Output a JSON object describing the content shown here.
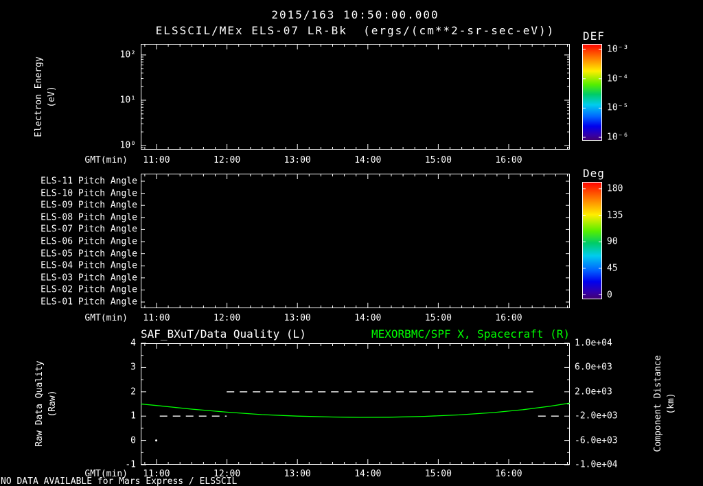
{
  "header": {
    "title": "2015/163 10:50:00.000",
    "subtitle": "ELSSCIL/MEx ELS-07 LR-Bk  (ergs/(cm**2-sr-sec-eV))"
  },
  "time_axis": {
    "label": "GMT(min)",
    "ticks": [
      "11:00",
      "12:00",
      "13:00",
      "14:00",
      "15:00",
      "16:00"
    ]
  },
  "energy_panel": {
    "ylabel": "Electron Energy\n(eV)",
    "yticks": [
      "10²",
      "10¹",
      "10⁰"
    ],
    "colorbar": {
      "title": "DEF",
      "ticks": [
        "10⁻³",
        "10⁻⁴",
        "10⁻⁵",
        "10⁻⁶"
      ]
    }
  },
  "pitch_panel": {
    "row_labels": [
      "ELS-11 Pitch Angle",
      "ELS-10 Pitch Angle",
      "ELS-09 Pitch Angle",
      "ELS-08 Pitch Angle",
      "ELS-07 Pitch Angle",
      "ELS-06 Pitch Angle",
      "ELS-05 Pitch Angle",
      "ELS-04 Pitch Angle",
      "ELS-03 Pitch Angle",
      "ELS-02 Pitch Angle",
      "ELS-01 Pitch Angle"
    ],
    "colorbar": {
      "title": "Deg",
      "ticks": [
        "180",
        "135",
        "90",
        "45",
        "0"
      ]
    }
  },
  "quality_panel": {
    "left_title": "SAF_BXuT/Data Quality (L)",
    "right_title": "MEXORBMC/SPF X, Spacecraft (R)",
    "left_ylabel": "Raw Data Quality\n(Raw)",
    "left_yticks": [
      "4",
      "3",
      "2",
      "1",
      "0",
      "-1"
    ],
    "right_ylabel": "Component Distance\n(km)",
    "right_yticks": [
      "1.0e+04",
      "6.0e+03",
      "2.0e+03",
      "-2.0e+03",
      "-6.0e+03",
      "-1.0e+04"
    ]
  },
  "status": "NO DATA AVAILABLE for Mars Express / ELSSCIL",
  "colors": {
    "foreground": "#ffffff",
    "background": "#000000",
    "series_green": "#00ff00"
  },
  "chart_data": [
    {
      "type": "heatmap",
      "panel": "electron-energy-spectrogram",
      "title": "ELSSCIL/MEx ELS-07 LR-Bk",
      "units": "ergs/(cm**2-sr-sec-eV)",
      "xlabel": "GMT(min)",
      "ylabel": "Electron Energy (eV)",
      "y_scale": "log",
      "y_tick_values": [
        100,
        10,
        1
      ],
      "x_ticks": [
        "11:00",
        "12:00",
        "13:00",
        "14:00",
        "15:00",
        "16:00"
      ],
      "colorbar": {
        "title": "DEF",
        "tick_values": [
          0.001,
          0.0001,
          1e-05,
          1e-06
        ]
      },
      "values": [],
      "note": "panel empty - no data available"
    },
    {
      "type": "heatmap",
      "panel": "pitch-angles",
      "rows": [
        "ELS-11",
        "ELS-10",
        "ELS-09",
        "ELS-08",
        "ELS-07",
        "ELS-06",
        "ELS-05",
        "ELS-04",
        "ELS-03",
        "ELS-02",
        "ELS-01"
      ],
      "x_ticks": [
        "11:00",
        "12:00",
        "13:00",
        "14:00",
        "15:00",
        "16:00"
      ],
      "colorbar": {
        "title": "Deg",
        "tick_values": [
          180,
          135,
          90,
          45,
          0
        ]
      },
      "values": [],
      "note": "panel empty - no data available"
    },
    {
      "type": "line",
      "panel": "quality-and-distance",
      "x_label": "GMT(min)",
      "x_ticks": [
        "11:00",
        "12:00",
        "13:00",
        "14:00",
        "15:00",
        "16:00"
      ],
      "x_range_hours": [
        10.78,
        16.87
      ],
      "left_axis": {
        "label": "Raw Data Quality (Raw)",
        "range": [
          -1,
          4
        ]
      },
      "right_axis": {
        "label": "Component Distance (km)",
        "range": [
          -10000,
          10000
        ]
      },
      "series": [
        {
          "name": "SAF_BXuT/Data Quality (L)",
          "axis": "left",
          "color": "#ffffff",
          "style": "dashed",
          "segments": [
            [
              [
                11.05,
                1
              ],
              [
                12.0,
                1
              ]
            ],
            [
              [
                12.0,
                2
              ],
              [
                16.35,
                2
              ]
            ],
            [
              [
                16.42,
                1
              ],
              [
                16.76,
                1
              ]
            ]
          ],
          "dots": [
            [
              11.0,
              0
            ]
          ]
        },
        {
          "name": "MEXORBMC/SPF X, Spacecraft (R)",
          "axis": "right",
          "color": "#00ff00",
          "style": "solid",
          "points": [
            [
              10.78,
              0
            ],
            [
              11.0,
              -250
            ],
            [
              11.5,
              -850
            ],
            [
              12.0,
              -1350
            ],
            [
              12.5,
              -1750
            ],
            [
              13.0,
              -2000
            ],
            [
              13.5,
              -2150
            ],
            [
              13.9,
              -2200
            ],
            [
              14.3,
              -2180
            ],
            [
              14.8,
              -2050
            ],
            [
              15.3,
              -1800
            ],
            [
              15.8,
              -1400
            ],
            [
              16.2,
              -950
            ],
            [
              16.6,
              -350
            ],
            [
              16.87,
              150
            ]
          ]
        }
      ]
    }
  ]
}
